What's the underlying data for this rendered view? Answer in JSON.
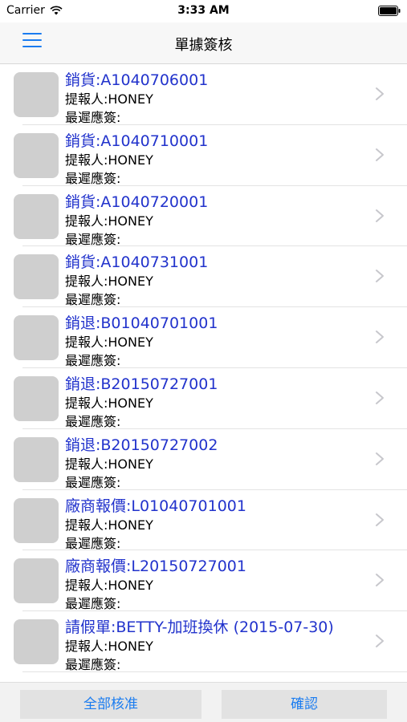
{
  "status_bar": {
    "carrier": "Carrier",
    "time": "3:33 AM"
  },
  "nav": {
    "title": "單據簽核",
    "menu_icon": "hamburger-menu-icon"
  },
  "list": [
    {
      "title": "銷貨:A1040706001",
      "submitter": "提報人:HONEY",
      "deadline": "最遲應簽:"
    },
    {
      "title": "銷貨:A1040710001",
      "submitter": "提報人:HONEY",
      "deadline": "最遲應簽:"
    },
    {
      "title": "銷貨:A1040720001",
      "submitter": "提報人:HONEY",
      "deadline": "最遲應簽:"
    },
    {
      "title": "銷貨:A1040731001",
      "submitter": "提報人:HONEY",
      "deadline": "最遲應簽:"
    },
    {
      "title": "銷退:B01040701001",
      "submitter": "提報人:HONEY",
      "deadline": "最遲應簽:"
    },
    {
      "title": "銷退:B20150727001",
      "submitter": "提報人:HONEY",
      "deadline": "最遲應簽:"
    },
    {
      "title": "銷退:B20150727002",
      "submitter": "提報人:HONEY",
      "deadline": "最遲應簽:"
    },
    {
      "title": "廠商報價:L01040701001",
      "submitter": "提報人:HONEY",
      "deadline": "最遲應簽:"
    },
    {
      "title": "廠商報價:L20150727001",
      "submitter": "提報人:HONEY",
      "deadline": "最遲應簽:"
    },
    {
      "title": "請假單:BETTY-加班換休 (2015-07-30)",
      "submitter": "提報人:HONEY",
      "deadline": "最遲應簽:"
    }
  ],
  "toolbar": {
    "approve_all": "全部核准",
    "confirm": "確認"
  },
  "colors": {
    "accent": "#1a7cf0",
    "title_link": "#2233cc",
    "thumb": "#cfcfcf"
  }
}
